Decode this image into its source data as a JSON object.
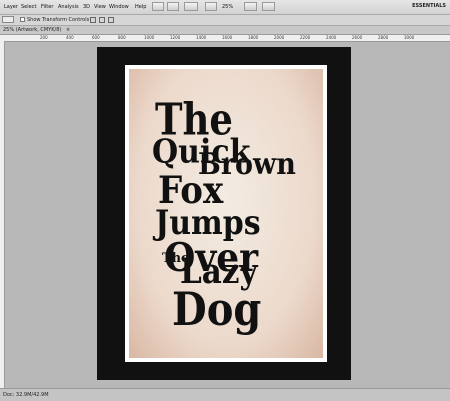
{
  "menu": [
    "Layer",
    "Select",
    "Filter",
    "Analysis",
    "3D",
    "View",
    "Window",
    "Help"
  ],
  "toolbar": {
    "zoom": "25%",
    "workspace": "ESSENTIALS"
  },
  "options_bar": {
    "show_transform_controls": "Show Transform Controls"
  },
  "document": {
    "tab_title": "25% (Artwork, CMYK/8)"
  },
  "ruler": {
    "ticks": [
      "200",
      "400",
      "600",
      "800",
      "1000",
      "1200",
      "1400",
      "1600",
      "1800",
      "2000",
      "2200",
      "2400",
      "2600",
      "2800",
      "3000"
    ]
  },
  "poster": {
    "words": [
      "The",
      "Quick",
      "Brown",
      "Fox",
      "Jumps",
      "Over",
      "The",
      "Lazy",
      "Dog"
    ]
  },
  "status": {
    "doc_size": "Doc: 32.9M/42.9M"
  }
}
